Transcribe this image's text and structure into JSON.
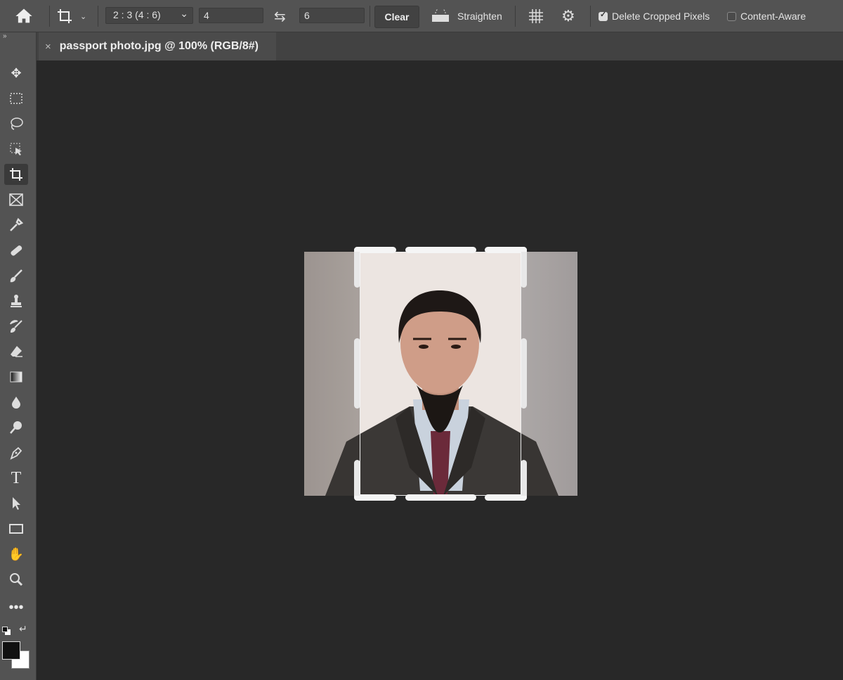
{
  "toolbar": {
    "home_icon": "home-icon",
    "crop_tool_icon": "crop-icon",
    "ratio_select": "2 : 3 (4 : 6)",
    "width_value": "4",
    "swap_icon": "swap-arrows-icon",
    "height_value": "6",
    "clear_label": "Clear",
    "straighten_label": "Straighten",
    "overlay_icon": "grid-overlay-icon",
    "settings_icon": "gear-icon",
    "delete_cropped_label": "Delete Cropped Pixels",
    "delete_cropped_checked": true,
    "content_aware_label": "Content-Aware",
    "content_aware_checked": false
  },
  "document": {
    "tab_title": "passport photo.jpg @ 100% (RGB/8#)"
  },
  "tools": [
    "move",
    "rectangular-marquee",
    "lasso",
    "object-selection",
    "crop",
    "frame",
    "eyedropper",
    "healing-brush",
    "brush",
    "clone-stamp",
    "history-brush",
    "eraser",
    "gradient",
    "blur",
    "dodge",
    "pen",
    "type",
    "path-selection",
    "rectangle",
    "hand",
    "zoom",
    "more"
  ],
  "colors": {
    "foreground": "#111111",
    "background": "#ffffff",
    "accent": "#535353"
  }
}
